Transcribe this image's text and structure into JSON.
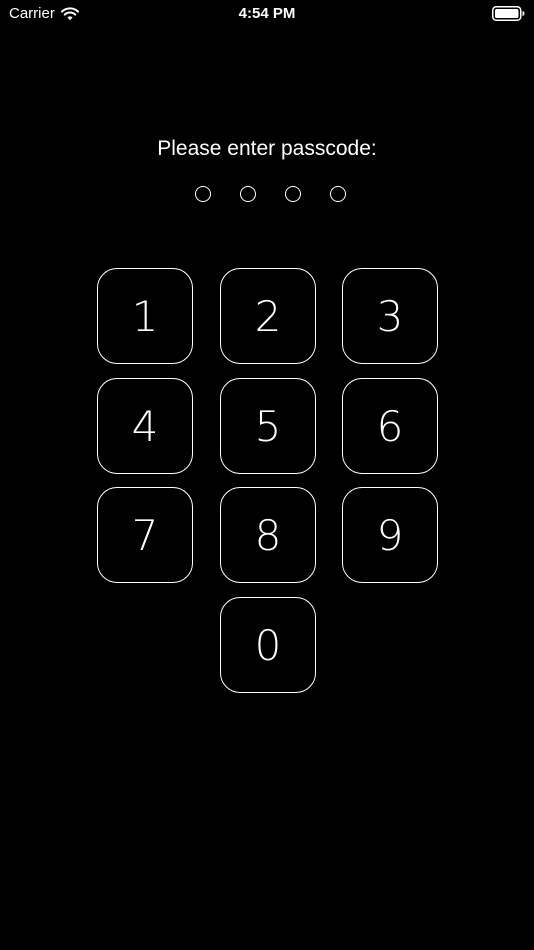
{
  "status_bar": {
    "carrier": "Carrier",
    "time": "4:54 PM",
    "icons": [
      "wifi-icon",
      "battery-icon"
    ]
  },
  "prompt": "Please enter passcode:",
  "passcode": {
    "length": 4,
    "entered": 0
  },
  "keypad": {
    "keys": [
      "1",
      "2",
      "3",
      "4",
      "5",
      "6",
      "7",
      "8",
      "9",
      "0"
    ]
  },
  "colors": {
    "background": "#000000",
    "foreground": "#ffffff"
  }
}
